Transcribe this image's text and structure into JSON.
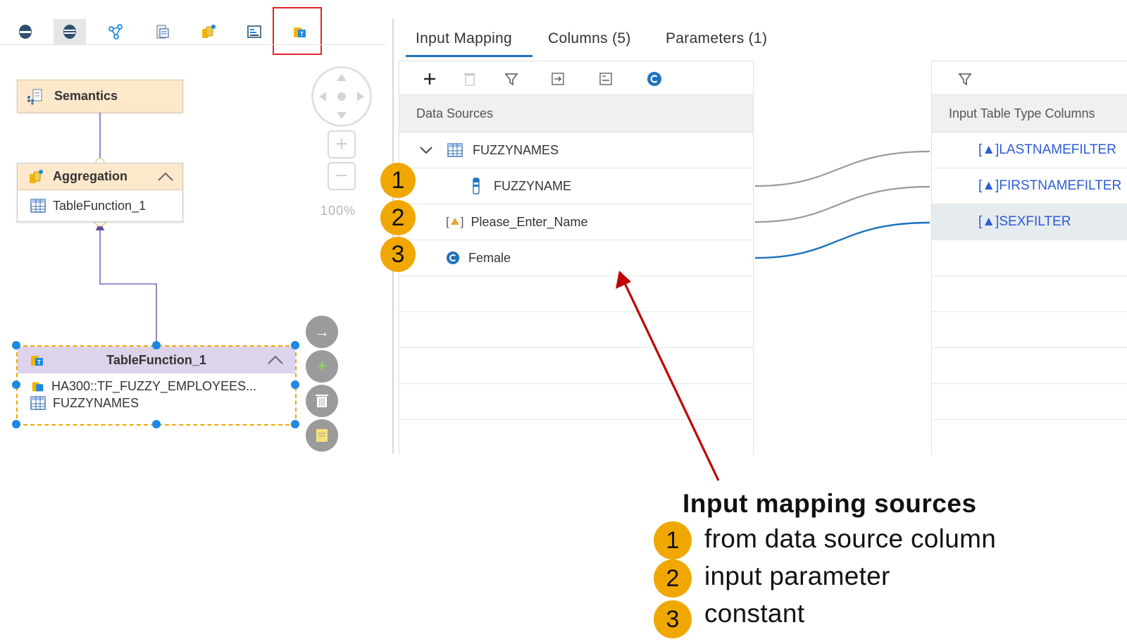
{
  "toolbar": {
    "items": [
      "union-icon",
      "join-icon",
      "graph-icon",
      "projection-icon",
      "aggregation-icon",
      "rank-icon",
      "table-function-icon"
    ]
  },
  "canvas": {
    "semantics_label": "Semantics",
    "aggregation_label": "Aggregation",
    "aggregation_child": "TableFunction_1",
    "tablefunction_label": "TableFunction_1",
    "tablefunction_line1": "HA300::TF_FUZZY_EMPLOYEES...",
    "tablefunction_line2": "FUZZYNAMES",
    "zoom": "100%"
  },
  "tabs": [
    {
      "label": "Input Mapping",
      "active": true
    },
    {
      "label": "Columns (5)"
    },
    {
      "label": "Parameters (1)"
    }
  ],
  "sources": {
    "header": "Data Sources",
    "group": "FUZZYNAMES",
    "column": "FUZZYNAME",
    "parameter": "Please_Enter_Name",
    "constant": "Female"
  },
  "targets": {
    "header": "Input Table Type Columns",
    "columns": [
      "[▲]LASTNAMEFILTER",
      "[▲]FIRSTNAMEFILTER",
      "[▲]SEXFILTER"
    ]
  },
  "badges": [
    "1",
    "2",
    "3"
  ],
  "legend": {
    "title": "Input mapping sources",
    "items": [
      {
        "num": "1",
        "text": "from data source column"
      },
      {
        "num": "2",
        "text": "input parameter"
      },
      {
        "num": "3",
        "text": "constant"
      }
    ]
  },
  "colors": {
    "accent": "#1e73be",
    "badge": "#f0a800",
    "arrow": "#c00000",
    "highlight": "#e3222a"
  }
}
